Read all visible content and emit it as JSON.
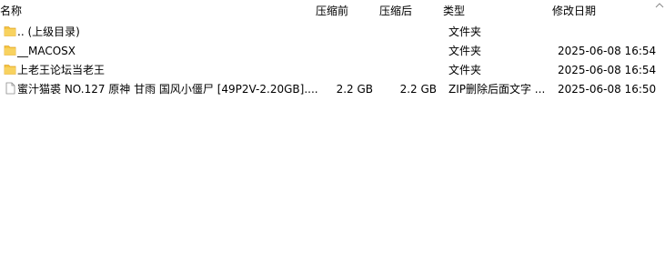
{
  "columns": {
    "name": "名称",
    "size": "压缩前",
    "packed": "压缩后",
    "type": "类型",
    "modified": "修改日期"
  },
  "rows": [
    {
      "icon": "folder-icon",
      "name": ".. (上级目录)",
      "size": "",
      "packed": "",
      "type": "文件夹",
      "modified": ""
    },
    {
      "icon": "folder-icon",
      "name": "__MACOSX",
      "size": "",
      "packed": "",
      "type": "文件夹",
      "modified": "2025-06-08 16:54"
    },
    {
      "icon": "folder-icon",
      "name": "上老王论坛当老王",
      "size": "",
      "packed": "",
      "type": "文件夹",
      "modified": "2025-06-08 16:54"
    },
    {
      "icon": "file-icon",
      "name": "蜜汁猫裘 NO.127 原神 甘雨 国风小僵尸 [49P2V-2.20GB]....",
      "size": "2.2 GB",
      "packed": "2.2 GB",
      "type": "ZIP删除后面文字 ...",
      "modified": "2025-06-08 16:50"
    }
  ],
  "colors": {
    "folder": "#f5c542",
    "folder_dark": "#e0a82e",
    "header_separator": "#e5e5e5"
  }
}
